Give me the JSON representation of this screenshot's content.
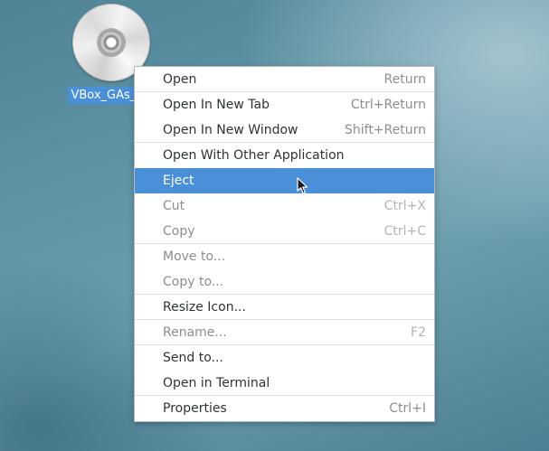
{
  "desktop": {
    "icon_label": "VBox_GAs_7"
  },
  "context_menu": {
    "items": [
      {
        "label": "Open",
        "accel": "Return",
        "enabled": true
      },
      {
        "label": "Open In New Tab",
        "accel": "Ctrl+Return",
        "enabled": true
      },
      {
        "label": "Open In New Window",
        "accel": "Shift+Return",
        "enabled": true
      },
      {
        "label": "Open With Other Application",
        "accel": "",
        "enabled": true
      },
      {
        "label": "Eject",
        "accel": "",
        "enabled": true,
        "highlighted": true
      },
      {
        "label": "Cut",
        "accel": "Ctrl+X",
        "enabled": false
      },
      {
        "label": "Copy",
        "accel": "Ctrl+C",
        "enabled": false
      },
      {
        "label": "Move to...",
        "accel": "",
        "enabled": false
      },
      {
        "label": "Copy to...",
        "accel": "",
        "enabled": false
      },
      {
        "label": "Resize Icon...",
        "accel": "",
        "enabled": true
      },
      {
        "label": "Rename...",
        "accel": "F2",
        "enabled": false
      },
      {
        "label": "Send to...",
        "accel": "",
        "enabled": true
      },
      {
        "label": "Open in Terminal",
        "accel": "",
        "enabled": true
      },
      {
        "label": "Properties",
        "accel": "Ctrl+I",
        "enabled": true
      }
    ]
  },
  "colors": {
    "selection": "#4a90d9",
    "menu_background": "#ffffff",
    "disabled_text": "#8b8e8f"
  },
  "icons": {
    "desktop_item": "optical-disc-icon",
    "pointer": "mouse-pointer-icon"
  }
}
